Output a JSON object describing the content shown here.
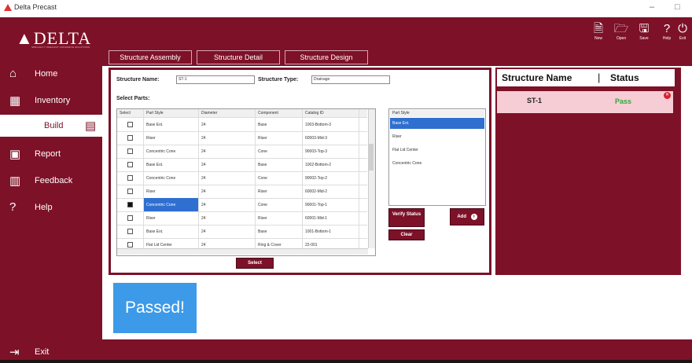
{
  "window": {
    "title": "Delta Precast",
    "controls": [
      "–",
      "□"
    ]
  },
  "header": {
    "logo": "DELTA",
    "logo_sub": "SPECIALTY PRECAST CONCRETE SOLUTIONS",
    "toolbar": [
      {
        "icon": "new-icon",
        "glyph": "🗎",
        "label": "New"
      },
      {
        "icon": "open-icon",
        "glyph": "🗁",
        "label": "Open"
      },
      {
        "icon": "save-icon",
        "glyph": "🖫",
        "label": "Save"
      },
      {
        "icon": "help-icon",
        "glyph": "?",
        "label": "Help"
      },
      {
        "icon": "exit-icon",
        "glyph": "⏻",
        "label": "Exit"
      }
    ]
  },
  "sidebar": {
    "items": [
      {
        "label": "Home",
        "icon": "home-icon",
        "glyph": "⌂"
      },
      {
        "label": "Inventory",
        "icon": "inventory-icon",
        "glyph": "▦"
      },
      {
        "label": "Build",
        "icon": "build-icon",
        "glyph": "▤",
        "active": true
      },
      {
        "label": "Report",
        "icon": "report-icon",
        "glyph": "▣"
      },
      {
        "label": "Feedback",
        "icon": "feedback-icon",
        "glyph": "▥"
      },
      {
        "label": "Help",
        "icon": "help-circle-icon",
        "glyph": "?"
      }
    ],
    "exit_label": "Exit",
    "exit_glyph": "⇥"
  },
  "tabs": [
    "Structure Assembly",
    "Structure Detail",
    "Structure Design"
  ],
  "form": {
    "structure_name_label": "Structure Name:",
    "structure_name_value": "ST-1",
    "structure_type_label": "Structure Type:",
    "structure_type_value": "Drainage",
    "select_parts_label": "Select Parts:"
  },
  "grid": {
    "columns": [
      "Select",
      "Part Style",
      "Diameter",
      "Component",
      "Catalog ID"
    ],
    "rows": [
      {
        "checked": false,
        "style": "Base Ext.",
        "diameter": "24",
        "component": "Base",
        "catalog": "1003-Bottom-3"
      },
      {
        "checked": false,
        "style": "Riser",
        "diameter": "24",
        "component": "Riser",
        "catalog": "60003-Mid-3"
      },
      {
        "checked": false,
        "style": "Concentric Cone",
        "diameter": "24",
        "component": "Cone",
        "catalog": "90003-Top-3"
      },
      {
        "checked": false,
        "style": "Base Ext.",
        "diameter": "24",
        "component": "Base",
        "catalog": "1002-Bottom-2"
      },
      {
        "checked": false,
        "style": "Concentric Cone",
        "diameter": "24",
        "component": "Cone",
        "catalog": "90002-Top-2"
      },
      {
        "checked": false,
        "style": "Riser",
        "diameter": "24",
        "component": "Riser",
        "catalog": "60002-Mid-2"
      },
      {
        "checked": true,
        "style": "Concentric Cone",
        "diameter": "24",
        "component": "Cone",
        "catalog": "90001-Top-1"
      },
      {
        "checked": false,
        "style": "Riser",
        "diameter": "24",
        "component": "Riser",
        "catalog": "60001-Mid-1"
      },
      {
        "checked": false,
        "style": "Base Ext.",
        "diameter": "24",
        "component": "Base",
        "catalog": "1001-Bottom-1"
      },
      {
        "checked": false,
        "style": "Flat Lid Center",
        "diameter": "24",
        "component": "Ring & Cover",
        "catalog": "22-001"
      }
    ],
    "select_button": "Select"
  },
  "part_list": {
    "header": "Part Style",
    "items": [
      "Base Ext.",
      "Riser",
      "Flat Lid Center",
      "Concentric Cone"
    ],
    "selected_index": 0
  },
  "buttons": {
    "verify": "Verify Status",
    "clear": "Clear",
    "add": "Add"
  },
  "status_panel": {
    "col_name": "Structure Name",
    "separator": "|",
    "col_status": "Status",
    "row_name": "ST-1",
    "row_status": "Pass",
    "pass_color": "#2eaa3c",
    "close_glyph": "✕"
  },
  "result_tile": "Passed!",
  "colors": {
    "brand": "#7d1128",
    "selection": "#2f6fcf",
    "tile": "#3d9ae8"
  }
}
